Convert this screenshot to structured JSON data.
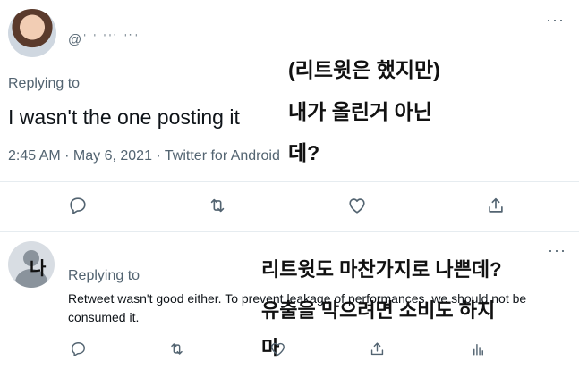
{
  "tweet1": {
    "handle": "@ˈ ˈ ˈˈ˙ ˈ˙ˈ",
    "more_dots": "···",
    "replying_to": "Replying to",
    "text": "I wasn't the one posting it",
    "meta": "2:45 AM · May 6, 2021 · Twitter for Android",
    "overlay_lines": [
      "(리트윗은 했지만)",
      "내가 올린거 아닌",
      "데?"
    ],
    "actions": [
      "reply-icon",
      "retweet-icon",
      "like-icon",
      "share-icon"
    ]
  },
  "tweet2": {
    "avatar_char": "나",
    "more_dots": "···",
    "replying_to": "Replying to",
    "text": "Retweet wasn't good either. To prevent leakage of performances, we should not be consumed it.",
    "overlay_lines": [
      "리트윗도 마찬가지로 나쁜데?",
      "유출을 막으려면 소비도 하지",
      "마"
    ],
    "actions": [
      "reply-icon",
      "retweet-icon",
      "like-icon",
      "share-icon",
      "analytics-icon"
    ]
  },
  "colors": {
    "secondary_text": "#536471",
    "primary_text": "#0f1419",
    "divider": "#e6ecf0"
  }
}
